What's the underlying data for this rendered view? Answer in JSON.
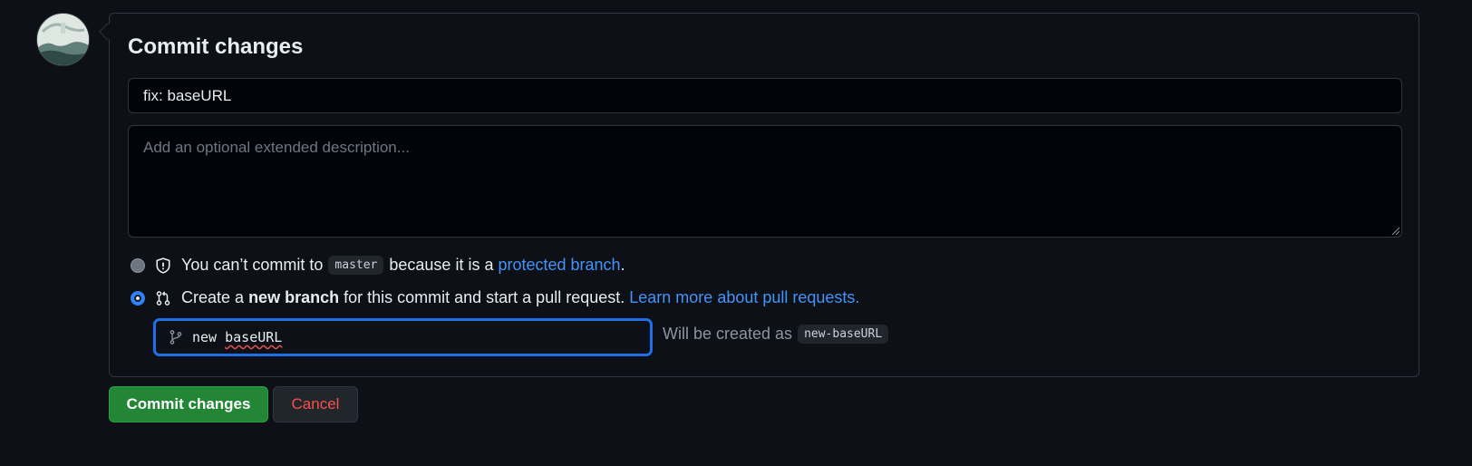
{
  "form": {
    "title": "Commit changes",
    "summary_value": "fix: baseURL",
    "description_placeholder": "Add an optional extended description..."
  },
  "options": {
    "direct": {
      "prefix": "You can’t commit to",
      "branch": "master",
      "middle": "because it is a",
      "link": "protected branch",
      "suffix": ".",
      "selected": false,
      "icon": "shield-icon"
    },
    "new_branch": {
      "prefix": "Create a",
      "bold": "new branch",
      "middle": "for this commit and start a pull request.",
      "link": "Learn more about pull requests.",
      "selected": true,
      "icon": "git-pull-request-icon"
    }
  },
  "branch_input": {
    "value_word1": "new",
    "value_word2": "baseURL",
    "icon": "git-branch-icon"
  },
  "created_as": {
    "label": "Will be created as",
    "branch": "new-baseURL"
  },
  "buttons": {
    "commit": "Commit changes",
    "cancel": "Cancel"
  },
  "colors": {
    "background": "#0d1117",
    "accent": "#2f81f7",
    "commit_button": "#238636",
    "cancel_text": "#f85149",
    "link": "#4493f8"
  }
}
